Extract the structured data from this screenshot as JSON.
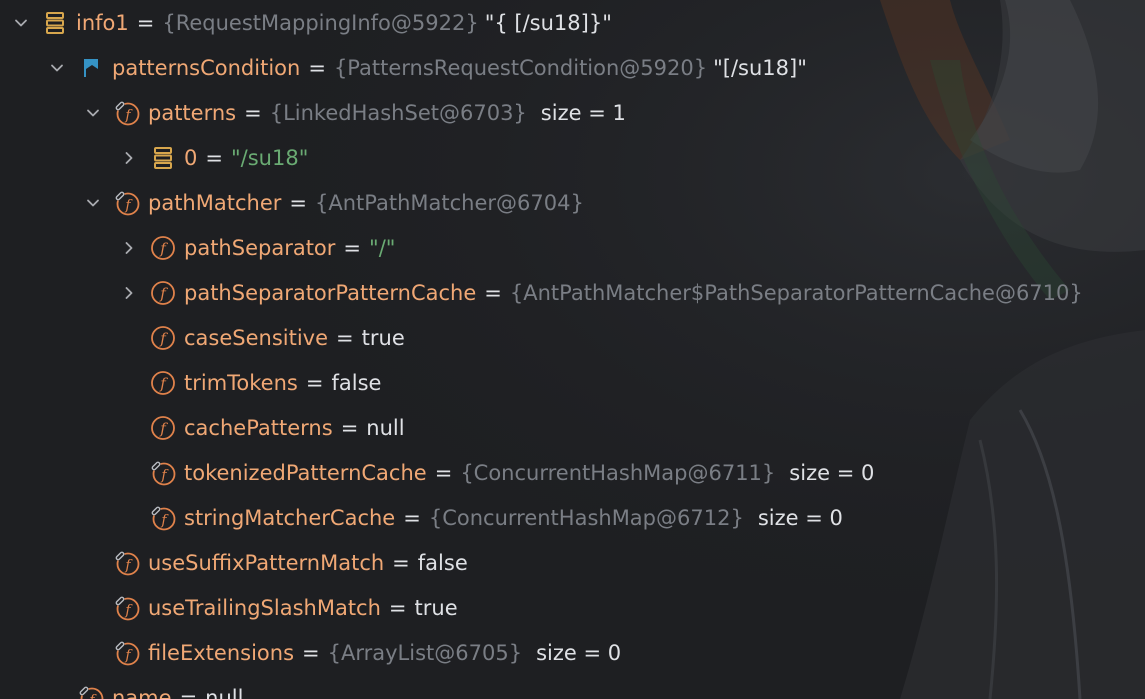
{
  "rows": [
    {
      "name": "info1",
      "ref": "{RequestMappingInfo@5922}",
      "value": "\"{ [/su18]}\"",
      "icon": "stack-icon",
      "state": "expanded"
    },
    {
      "name": "patternsCondition",
      "ref": "{PatternsRequestCondition@5920}",
      "value": "\"[/su18]\"",
      "icon": "flag-icon",
      "state": "expanded"
    },
    {
      "name": "patterns",
      "ref": "{LinkedHashSet@6703}",
      "extra": "size = 1",
      "icon": "field-final-icon",
      "state": "expanded"
    },
    {
      "name": "0",
      "string": "\"/su18\"",
      "icon": "stack-icon",
      "state": "collapsed"
    },
    {
      "name": "pathMatcher",
      "ref": "{AntPathMatcher@6704}",
      "icon": "field-final-icon",
      "state": "expanded"
    },
    {
      "name": "pathSeparator",
      "string": "\"/\"",
      "icon": "field-icon",
      "state": "collapsed"
    },
    {
      "name": "pathSeparatorPatternCache",
      "ref": "{AntPathMatcher$PathSeparatorPatternCache@6710}",
      "icon": "field-icon",
      "state": "collapsed"
    },
    {
      "name": "caseSensitive",
      "literal": "true",
      "icon": "field-icon",
      "state": "leaf"
    },
    {
      "name": "trimTokens",
      "literal": "false",
      "icon": "field-icon",
      "state": "leaf"
    },
    {
      "name": "cachePatterns",
      "literal": "null",
      "icon": "field-icon",
      "state": "leaf"
    },
    {
      "name": "tokenizedPatternCache",
      "ref": "{ConcurrentHashMap@6711}",
      "extra": "size = 0",
      "icon": "field-final-icon",
      "state": "leaf"
    },
    {
      "name": "stringMatcherCache",
      "ref": "{ConcurrentHashMap@6712}",
      "extra": "size = 0",
      "icon": "field-final-icon",
      "state": "leaf"
    },
    {
      "name": "useSuffixPatternMatch",
      "literal": "false",
      "icon": "field-final-icon",
      "state": "leaf"
    },
    {
      "name": "useTrailingSlashMatch",
      "literal": "true",
      "icon": "field-final-icon",
      "state": "leaf"
    },
    {
      "name": "fileExtensions",
      "ref": "{ArrayList@6705}",
      "extra": "size = 0",
      "icon": "field-final-icon",
      "state": "leaf"
    },
    {
      "name": "name",
      "literal": "null",
      "icon": "field-final-icon",
      "state": "leaf"
    }
  ],
  "colors": {
    "background": "#1e1f22",
    "field_name": "#f0a875",
    "reference": "#7a7e85",
    "string": "#6aab73",
    "text": "#dfe1e5",
    "flag": "#3592c4"
  }
}
